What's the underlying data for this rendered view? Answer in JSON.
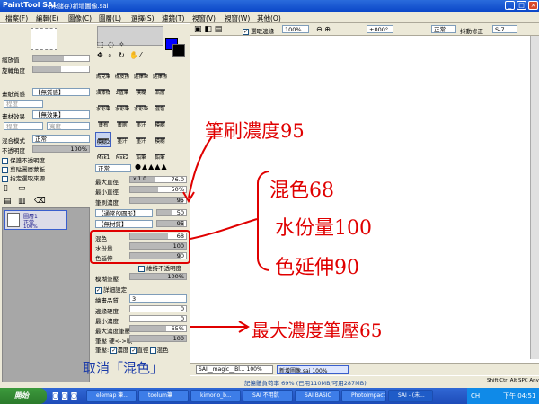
{
  "titlebar": {
    "logo": "PaintTool SAI",
    "title": "(未儲存)新增圖像.sai",
    "min": "_",
    "max": "□",
    "close": "×"
  },
  "menu": [
    "檔案(F)",
    "編輯(E)",
    "圖像(C)",
    "圖層(L)",
    "選擇(S)",
    "濾鏡(T)",
    "視窗(V)",
    "視窗(W)",
    "其他(O)"
  ],
  "nav": {
    "zoom_label": "縮放值",
    "zoom_value": "100%",
    "angle_label": "旋轉角度",
    "angle_value": "+000"
  },
  "layer_panel": {
    "texture_label": "畫紙質感",
    "texture_value": "【無質感】",
    "effect_label": "畫材效果",
    "effect_value": "【無效果】",
    "degree_label": "程度",
    "width_label": "寬度",
    "blend_label": "混合模式",
    "blend_value": "正常",
    "opacity_label": "不透明度",
    "opacity_value": "100%",
    "protect_label": "保護不透明度",
    "clip_label": "剪貼圖層蒙板",
    "select_src_label": "指定選取來源",
    "layer_name": "圖層1",
    "layer_mode": "正常",
    "layer_opacity": "100%"
  },
  "tools": [
    [
      "馬克筆",
      "橡皮擦",
      "選擇筆",
      "選擇擦"
    ],
    [
      "油漆桶",
      "2值筆",
      "模糊",
      "漸層"
    ],
    [
      "水彩筆",
      "水彩筆",
      "水彩筆",
      "混色"
    ],
    [
      "畫布",
      "畫刷",
      "墨汁",
      "模糊"
    ],
    [
      "模糊2",
      "墨汁",
      "墨汁",
      "模糊"
    ],
    [
      "Msk1",
      "Msk2",
      "鉛筆",
      "鉛筆"
    ]
  ],
  "brush": {
    "mode": "正常",
    "max_size_label": "最大直徑",
    "max_size_mult": "x 1.0",
    "max_size_value": "76.0",
    "min_size_label": "最小直徑",
    "min_size_value": "50%",
    "density_label": "筆刷濃度",
    "density_value": "95",
    "shape_value": "【通常的圓形】",
    "shape_num": "50",
    "texture_value": "【無材質】",
    "texture_num": "95",
    "blend_label": "混色",
    "blend_value": "68",
    "dilution_label": "水份量",
    "dilution_value": "100",
    "persistence_label": "色延伸",
    "persistence_value": "90",
    "keep_opacity_label": "維持不透明度",
    "blur_label": "模糊筆壓",
    "blur_value": "100%",
    "detail_label": "詳細設定",
    "quality_label": "繪畫品質",
    "quality_value": "3",
    "edge_label": "邊緣硬度",
    "edge_value": "0",
    "min_density_label": "最小濃度",
    "min_density_value": "0",
    "max_pressure_label": "最大濃度筆壓",
    "max_pressure_value": "65%",
    "pressure_label": "筆壓 硬<->軟",
    "pressure_value": "100",
    "pressure_opts_label": "筆壓:",
    "opt_density": "濃度",
    "opt_size": "直徑",
    "opt_blend": "混色"
  },
  "canvasbar": {
    "select_edge": "選取邊緣",
    "zoom": "100%",
    "angle": "+000°",
    "mode": "正常",
    "stabilizer_label": "抖動修正",
    "stabilizer": "S-7"
  },
  "annotations": {
    "density": "筆刷濃度95",
    "blend": "混色68",
    "dilution": "水份量100",
    "persistence": "色延伸90",
    "max_pressure": "最大濃度筆壓65",
    "uncheck": "取消「混色」"
  },
  "doc_tabs": [
    {
      "name": "SAI__magic__Bl...",
      "zoom": "100%"
    },
    {
      "name": "新增圖像.sai",
      "zoom": "100%"
    }
  ],
  "status": {
    "memory": "記憶體負荷率 69% (已用110MB/可用287MB)",
    "keys": "Shift Ctrl Alt SPC Any"
  },
  "taskbar": {
    "start": "開始",
    "items": [
      "elemap 筆...",
      "toolum筆",
      "kimono_b...",
      "SAI 不用骯",
      "SAI BASIC",
      "PhotoImpact",
      "SAI - (未..."
    ],
    "tray_lang": "CH",
    "clock": "下午 04:51"
  },
  "colors": {
    "primary": "#0000ff",
    "secondary": "#000000",
    "annotation": "#e00000"
  }
}
